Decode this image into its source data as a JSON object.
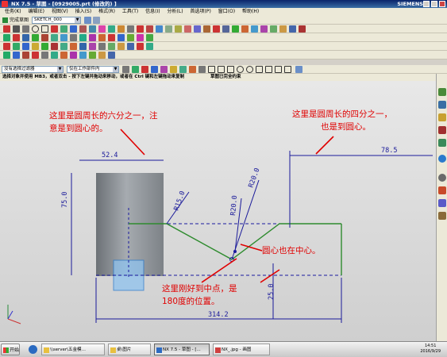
{
  "window": {
    "title": "NX 7.5 - 草图 - [0929005.prt (修改的) ]",
    "brand": "SIEMENS"
  },
  "menu": [
    "任务(K)",
    "编辑(E)",
    "视图(V)",
    "插入(S)",
    "格式(R)",
    "工具(T)",
    "信息(I)",
    "分析(L)",
    "首选项(P)",
    "窗口(O)",
    "帮助(H)"
  ],
  "sketch_toolbar": {
    "finish_label": "完成草图",
    "sketch_name": "SKETCH_000"
  },
  "selection": {
    "filter": "没有选择过滤器",
    "scope": "仅在工作部件内"
  },
  "status": {
    "prompt": "选择对象并使用 MB3，或者双击 - 按下左键并拖动来移动，或者在 Ctrl 键和左键拖动来复制",
    "sketch_state": "草图已完全约束"
  },
  "dimensions": {
    "d52": "52.4",
    "d75": "75.0",
    "d785": "78.5",
    "r15": "R15.0",
    "r20a": "R20.0",
    "r20b": "R20.0",
    "d25": "25.0",
    "d3142": "314.2"
  },
  "annotations": {
    "sixth_line1": "这里是圆周长的六分之一，注",
    "sixth_line2": "意是到圆心的。",
    "quarter_line1": "这里是圆周长的四分之一，",
    "quarter_line2": "也是到圆心。",
    "center": "圆心也在中心。",
    "mid_line1": "这里刚好到中点，是",
    "mid_line2": "180度的位置。"
  },
  "taskbar": {
    "start": "开始",
    "tasks": [
      "\\\\server\\五金模…",
      "桌\\图片",
      "NX 7.5 - 草图 - [...",
      "NX_.jpg - 画图"
    ],
    "time": "14:51",
    "date": "2016/9/29"
  },
  "colors": {
    "annotation": "#e00000",
    "sketch_line": "#2e8b2e",
    "dimension": "#1a1a9a",
    "cylinder": "#8c9196"
  }
}
